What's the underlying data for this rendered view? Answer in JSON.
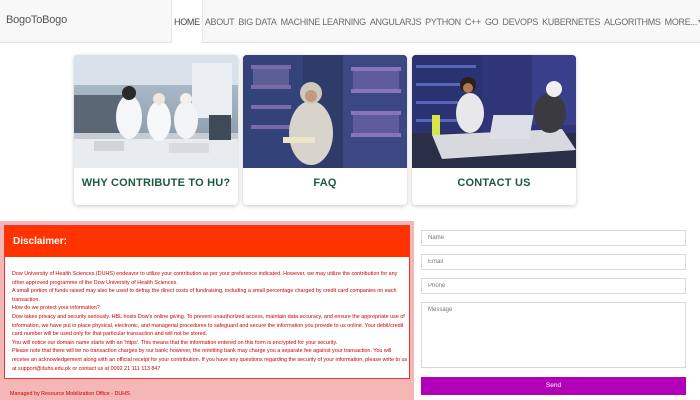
{
  "brand": "BogoToBogo",
  "nav": {
    "items": [
      "HOME",
      "ABOUT",
      "BIG DATA",
      "MACHINE LEARNING",
      "ANGULARJS",
      "PYTHON",
      "C++",
      "GO",
      "DEVOPS",
      "KUBERNETES",
      "ALGORITHMS",
      "MORE..."
    ],
    "active": "HOME"
  },
  "cards": [
    {
      "title": "WHY CONTRIBUTE TO HU?",
      "image": "lab-researchers-photo"
    },
    {
      "title": "FAQ",
      "image": "library-student-photo"
    },
    {
      "title": "CONTACT US",
      "image": "library-laptop-students-photo"
    }
  ],
  "disclaimer": {
    "title": "Disclaimer:",
    "paragraphs": [
      "Dow University of Health Sciences (DUHS) endeavor to utilize your contribution as per your preference indicated. However, we may utilize the contribution for any other approved programme of the Dow University of Health Sciences.",
      "A small portion of funds raised may also be used to defray the direct costs of fundraising, including a small percentage charged by credit card companies on each transaction.",
      "How do we protect your information?",
      "Dow takes privacy and security seriously. HBL hosts Dow's online giving. To prevent unauthorized access, maintain data accuracy, and ensure the appropriate use of information, we have put in place physical, electronic, and managerial procedures to safeguard and secure the information you provide to us online. Your debit/credit card number will be used only for that particular transaction and will not be stored.",
      "You will notice our domain name starts with an 'https'. This means that the information entered on this form is encrypted for your security.",
      "Please note that there will be no transaction charges by our bank; however, the remitting bank may charge you a separate fee against your transaction. You will receive an acknowledgement along with an official receipt for your contribution. If you have any questions regarding the security of your information, please write to us at support@duhs.edu.pk or contact us at 0092 21 111 113 847"
    ],
    "footer": "Managed by Resource Mobilization Office - DUHS."
  },
  "form": {
    "name_placeholder": "Name",
    "email_placeholder": "Email",
    "phone_placeholder": "Phone",
    "message_placeholder": "Message",
    "send_label": "Send"
  },
  "colors": {
    "accent_red": "#ff3300",
    "send_purple": "#b300b8",
    "card_title_green": "#1d5a3c"
  }
}
